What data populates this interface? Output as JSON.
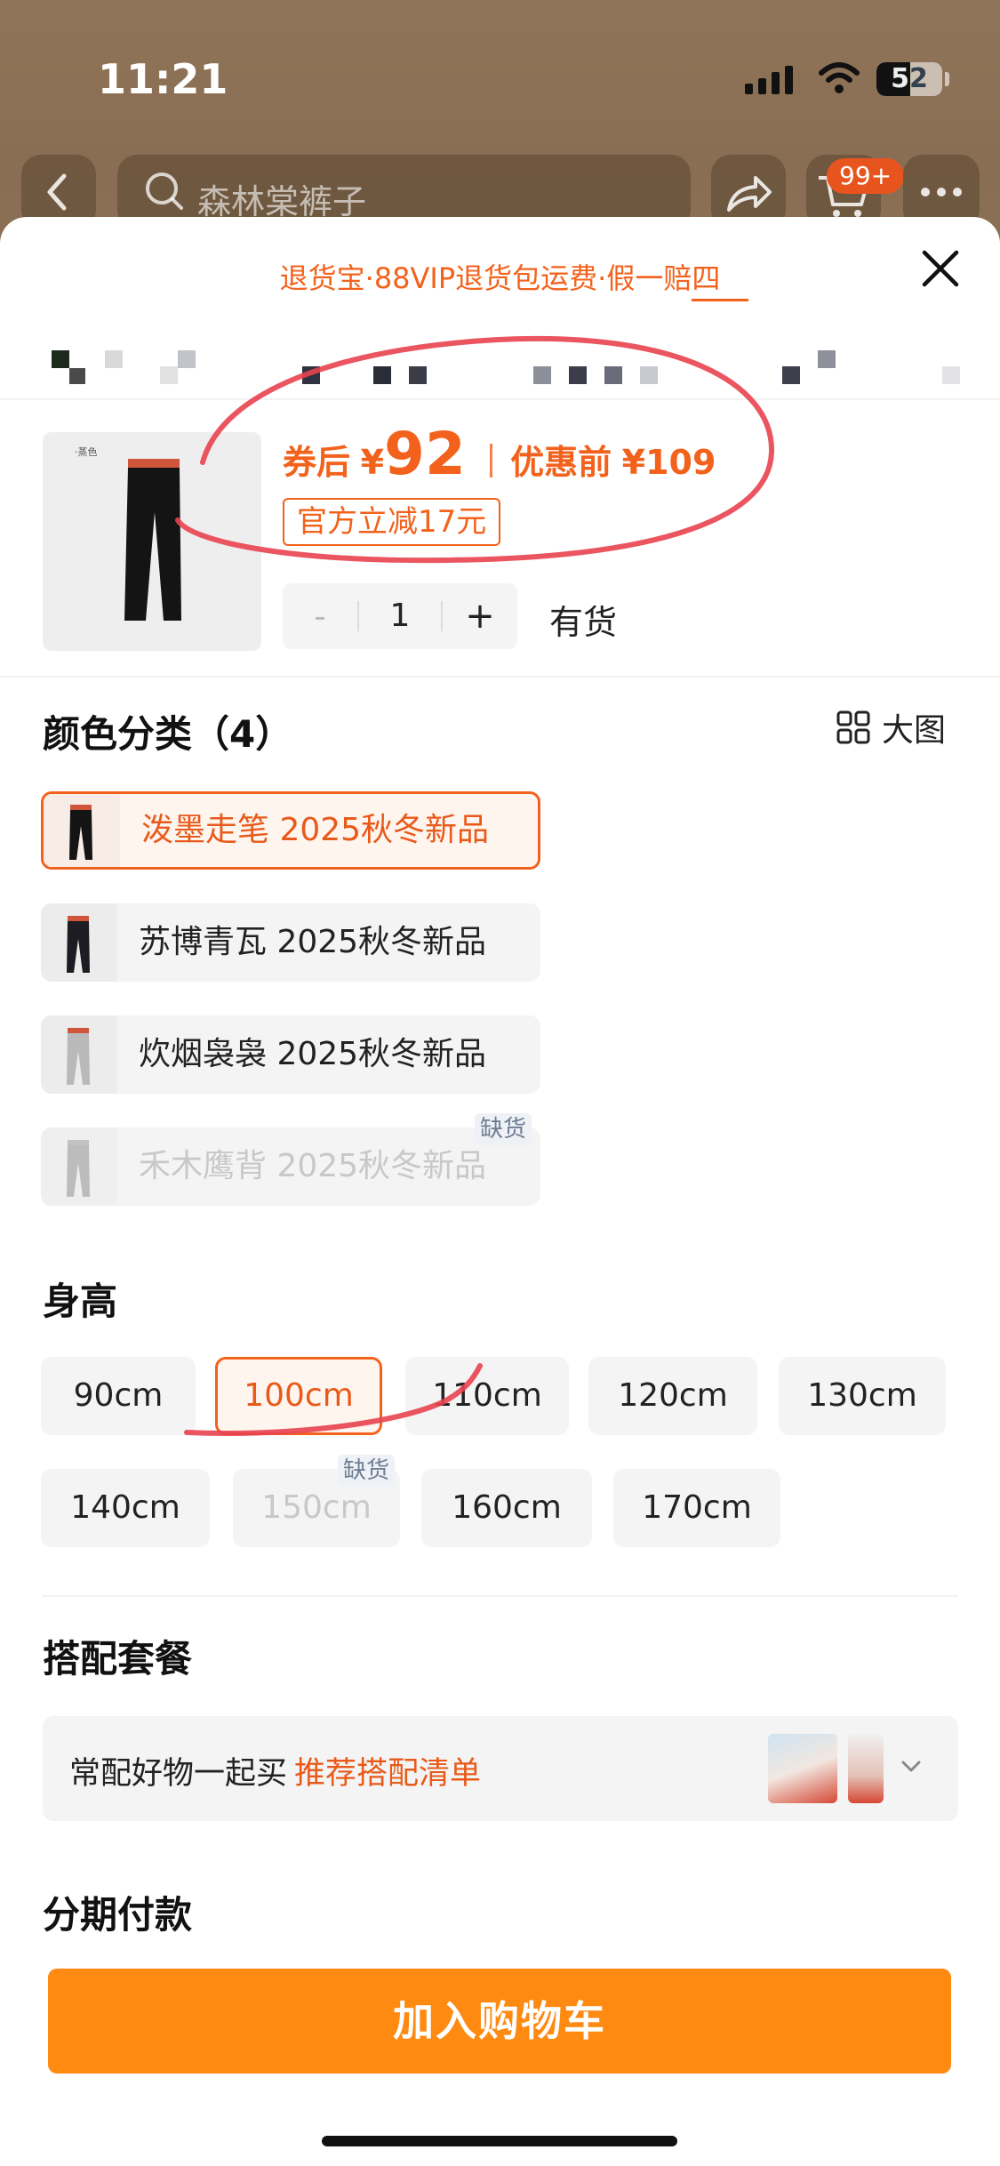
{
  "status_bar": {
    "time": "11:21",
    "battery": "52"
  },
  "top_nav": {
    "search_text": "森林棠裤子",
    "cart_badge": "99+"
  },
  "sheet": {
    "promo_banner": "退货宝·88VIP退货包运费·假一赔四",
    "product": {
      "thumb_tag": "·蒸色",
      "price_prefix": "券后",
      "price_symbol": "¥",
      "price_value": "92",
      "original_label": "优惠前",
      "original_price": "¥109",
      "discount_tag": "官方立减17元",
      "quantity": "1",
      "minus": "-",
      "plus": "+",
      "stock_status": "有货"
    },
    "color_section": {
      "title": "颜色分类（4）",
      "big_view_label": "大图",
      "options": [
        {
          "label": "泼墨走笔 2025秋冬新品",
          "state": "selected"
        },
        {
          "label": "苏博青瓦 2025秋冬新品",
          "state": "normal"
        },
        {
          "label": "炊烟袅袅 2025秋冬新品",
          "state": "normal"
        },
        {
          "label": "禾木鹰背 2025秋冬新品",
          "state": "disabled",
          "badge": "缺货"
        }
      ]
    },
    "height_section": {
      "title": "身高",
      "options": [
        {
          "label": "90cm",
          "state": "normal"
        },
        {
          "label": "100cm",
          "state": "selected"
        },
        {
          "label": "110cm",
          "state": "normal"
        },
        {
          "label": "120cm",
          "state": "normal"
        },
        {
          "label": "130cm",
          "state": "normal"
        },
        {
          "label": "140cm",
          "state": "normal"
        },
        {
          "label": "150cm",
          "state": "disabled",
          "badge": "缺货"
        },
        {
          "label": "160cm",
          "state": "normal"
        },
        {
          "label": "170cm",
          "state": "normal"
        }
      ]
    },
    "bundle_section": {
      "title": "搭配套餐",
      "text": "常配好物一起买",
      "link": "推荐搭配清单"
    },
    "installment_section": {
      "title": "分期付款"
    },
    "add_to_cart": "加入购物车"
  },
  "colors": {
    "accent": "#f3621c",
    "cta": "#fe8a12",
    "annotation": "#e8424f",
    "oos_badge_text": "#6f7d92"
  },
  "icons": [
    "back-arrow-icon",
    "search-icon",
    "share-icon",
    "cart-icon",
    "more-icon",
    "close-icon",
    "grid-icon",
    "chevron-down-icon"
  ]
}
